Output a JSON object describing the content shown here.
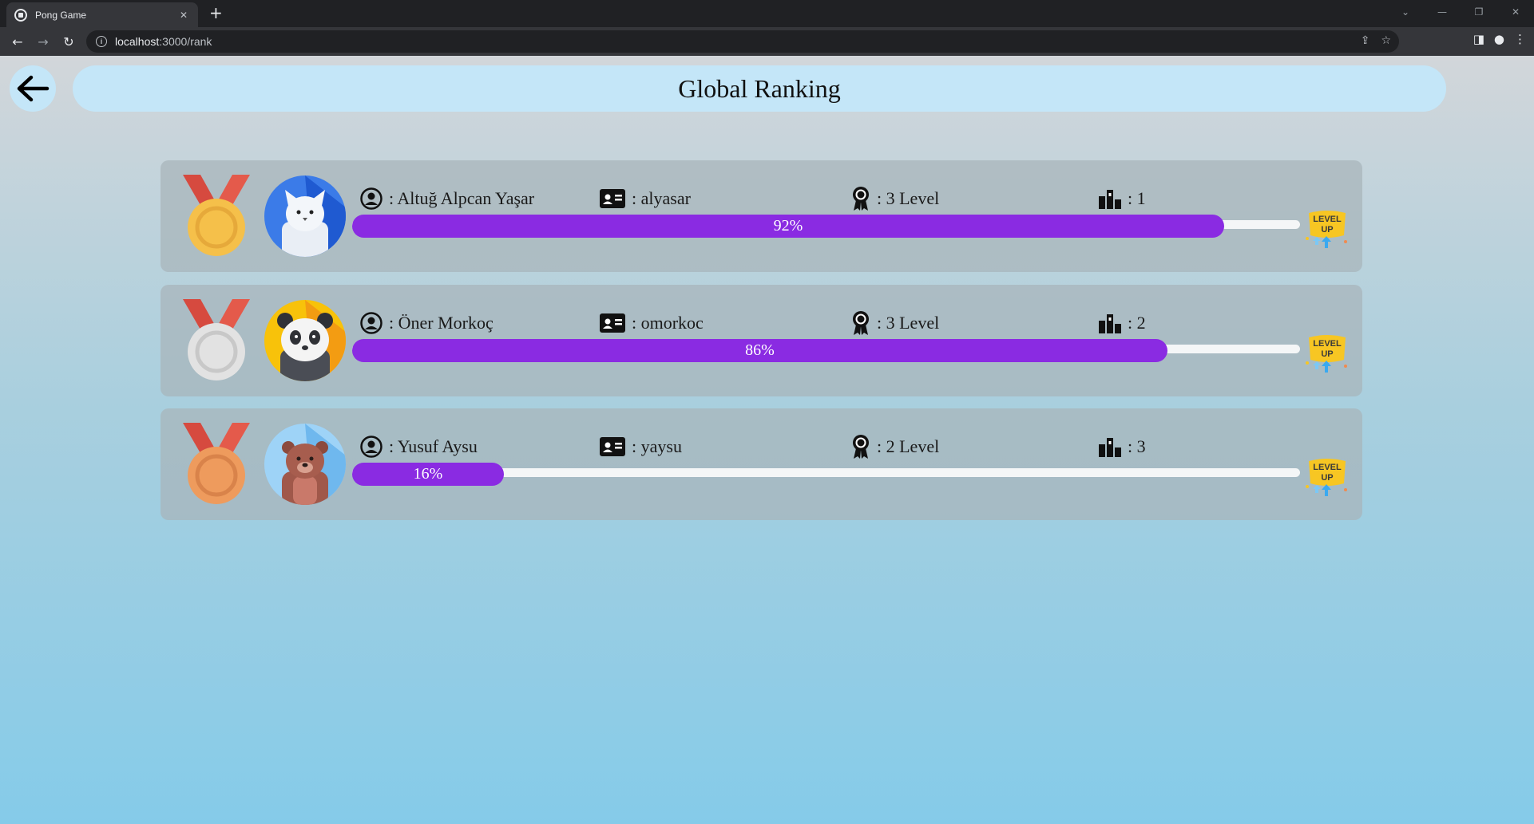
{
  "browser": {
    "tab_title": "Pong Game",
    "url_host": "localhost",
    "url_path": ":3000/rank"
  },
  "page": {
    "title": "Global Ranking"
  },
  "rankings": [
    {
      "full_name": ": Altuğ Alpcan Yaşar",
      "username": ": alyasar",
      "level": ": 3 Level",
      "rank": ": 1",
      "progress_label": "92%",
      "progress": 0.92,
      "medal": "gold-medal-icon",
      "avatar": "cat-avatar"
    },
    {
      "full_name": ": Öner Morkoç",
      "username": ": omorkoc",
      "level": ": 3 Level",
      "rank": ": 2",
      "progress_label": "86%",
      "progress": 0.86,
      "medal": "silver-medal-icon",
      "avatar": "panda-avatar"
    },
    {
      "full_name": ": Yusuf Aysu",
      "username": ": yaysu",
      "level": ": 2 Level",
      "rank": ": 3",
      "progress_label": "16%",
      "progress": 0.16,
      "medal": "bronze-medal-icon",
      "avatar": "bear-avatar"
    }
  ],
  "badge": {
    "line1": "LEVEL",
    "line2": "UP"
  },
  "colors": {
    "progress_fill": "#8a2be2",
    "header_bg": "#c4e6f8",
    "gold": "#f5c04a",
    "silver": "#d9d9d9",
    "bronze": "#ee9b5d"
  }
}
